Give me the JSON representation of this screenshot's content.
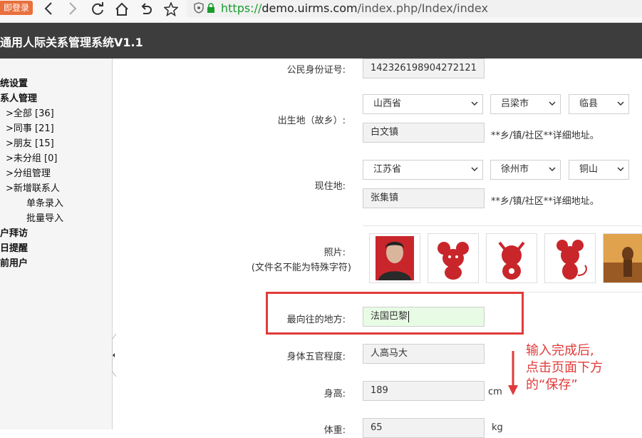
{
  "browser": {
    "login_badge": "即登录",
    "url_scheme": "https://",
    "url_host": "demo.uirms.com",
    "url_path": "/index.php/Index/index"
  },
  "app": {
    "title": "通用人际关系管理系统V1.1"
  },
  "sidebar": {
    "items": [
      {
        "label": "统设置",
        "bold": true
      },
      {
        "label": "系人管理",
        "bold": true
      },
      {
        "label": ">全部 [36]",
        "bold": false
      },
      {
        "label": ">同事 [21]",
        "bold": false
      },
      {
        "label": ">朋友 [15]",
        "bold": false
      },
      {
        "label": ">未分组 [0]",
        "bold": false
      },
      {
        "label": ">分组管理",
        "bold": false
      },
      {
        "label": ">新增联系人",
        "bold": false
      },
      {
        "label": "单条录入",
        "bold": false
      },
      {
        "label": "批量导入",
        "bold": false
      },
      {
        "label": "户拜访",
        "bold": true
      },
      {
        "label": "日提醒",
        "bold": true
      },
      {
        "label": "前用户",
        "bold": true
      }
    ]
  },
  "form": {
    "id_number": {
      "label": "公民身份证号:",
      "value": "142326198904272121"
    },
    "birthplace": {
      "label": "出生地（故乡）:",
      "province": "山西省",
      "city": "吕梁市",
      "county": "临县",
      "detail": "白文镇",
      "hint": "**乡/镇/社区**详细地址。"
    },
    "residence": {
      "label": "现住地:",
      "province": "江苏省",
      "city": "徐州市",
      "county": "铜山",
      "detail": "张集镇",
      "hint": "**乡/镇/社区**详细地址。"
    },
    "photo": {
      "label": "照片:",
      "note": "(文件名不能为特殊字符)"
    },
    "favorite_place": {
      "label": "最向往的地方:",
      "value": "法国巴黎"
    },
    "features": {
      "label": "身体五官程度:",
      "value": "人高马大"
    },
    "height": {
      "label": "身高:",
      "value": "189",
      "unit": "cm"
    },
    "weight": {
      "label": "体重:",
      "value": "65",
      "unit": "kg"
    }
  },
  "annotation": {
    "line1": "输入完成后,",
    "line2": "点击页面下方",
    "line3": "的“保存”",
    "color": "#e03b3b"
  }
}
